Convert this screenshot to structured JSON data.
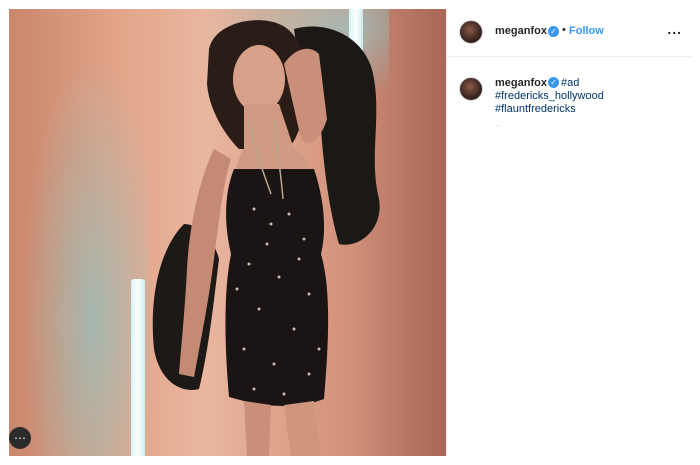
{
  "post": {
    "header": {
      "username": "meganfox",
      "follow_label": "Follow",
      "separator": "•",
      "more_label": "..."
    },
    "caption": {
      "username": "meganfox",
      "hashtags": [
        "#ad",
        "#fredericks_hollywood",
        "#flauntfredericks"
      ],
      "faint_text": "..."
    },
    "photo_menu_label": "⋯"
  },
  "colors": {
    "link": "#3897f0",
    "hashtag": "#003569",
    "verified": "#3897f0"
  },
  "icons": [
    "verified-badge-icon",
    "more-options-icon",
    "avatar-image"
  ]
}
